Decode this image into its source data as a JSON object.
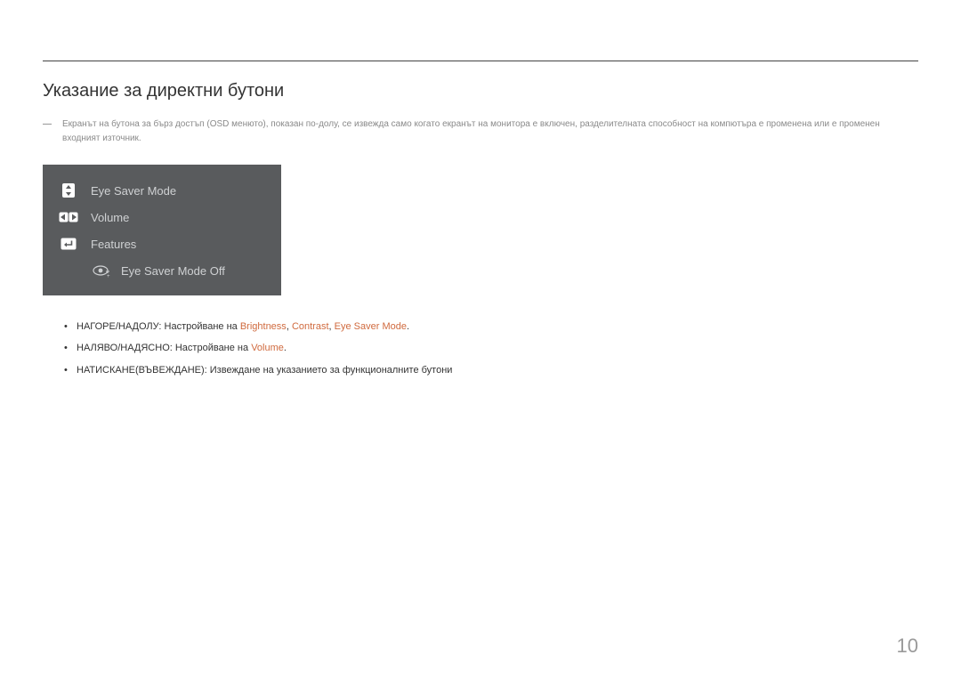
{
  "section_title": "Указание за директни бутони",
  "note_text": "Екранът на бутона за бърз достъп (OSD менюто), показан по-долу, се извежда само когато екранът на монитора е включен, разделителната способност на компютъра е променена или е променен входният източник.",
  "osd": {
    "rows": [
      {
        "label": "Eye Saver Mode"
      },
      {
        "label": "Volume"
      },
      {
        "label": "Features"
      }
    ],
    "status_label": "Eye Saver Mode Off"
  },
  "list": {
    "row0": {
      "prefix": "НАГОРЕ/НАДОЛУ: Настройване на ",
      "hl1": "Brightness",
      "sep1": ", ",
      "hl2": "Contrast",
      "sep2": ", ",
      "hl3": "Eye Saver Mode",
      "suffix": "."
    },
    "row1": {
      "prefix": "НАЛЯВО/НАДЯСНО: Настройване на ",
      "hl1": "Volume",
      "suffix": "."
    },
    "row2": {
      "text": "НАТИСКАНЕ(ВЪВЕЖДАНЕ): Извеждане на указанието за функционалните бутони"
    }
  },
  "page_number": "10"
}
